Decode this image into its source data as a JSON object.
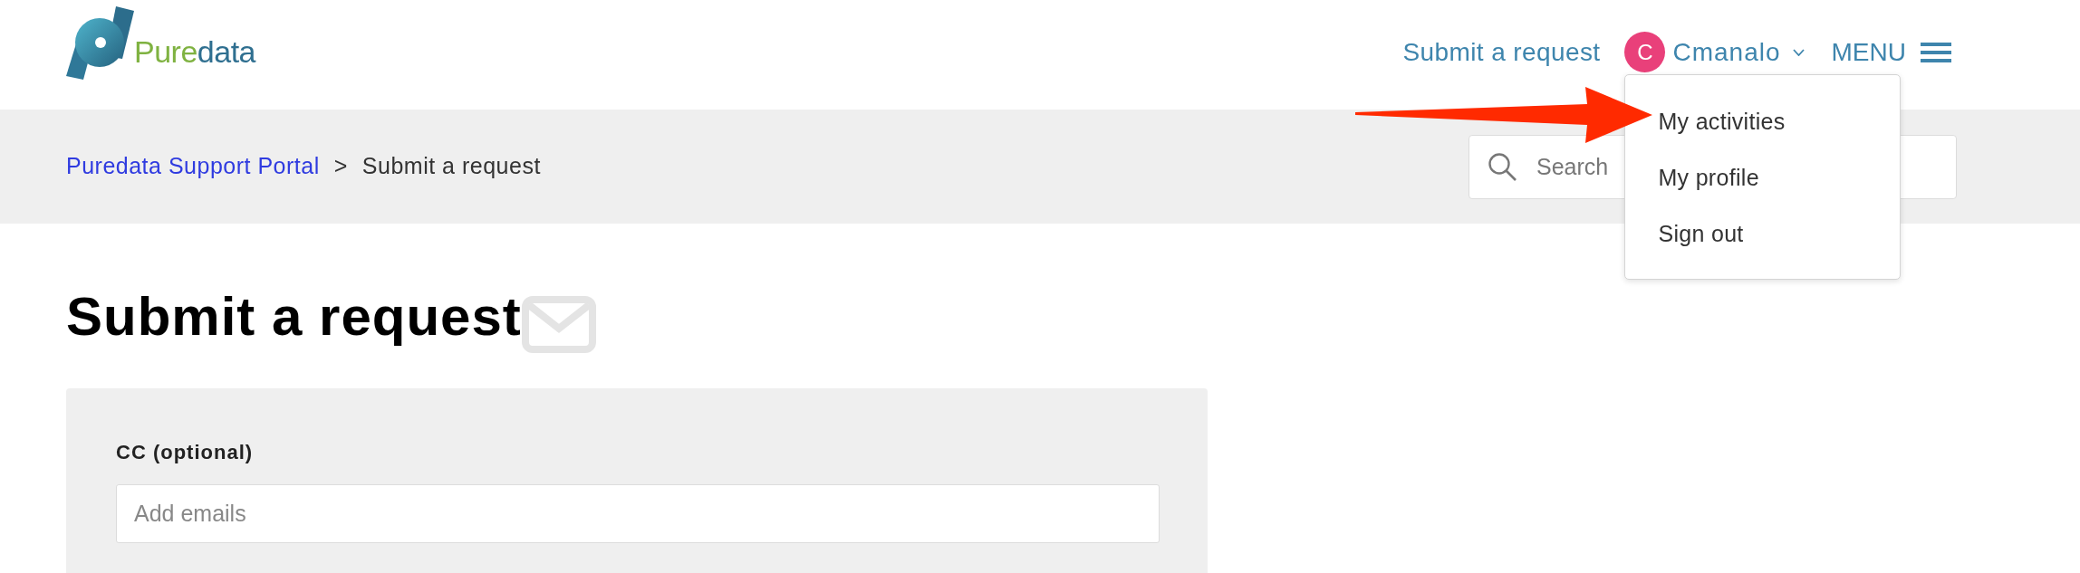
{
  "logo": {
    "brand_first": "Pure",
    "brand_second": "data"
  },
  "header": {
    "nav_link": "Submit a request",
    "user": {
      "initial": "C",
      "name": "Cmanalo"
    },
    "menu_button": "MENU"
  },
  "user_menu": {
    "expanded": true,
    "items": [
      {
        "label": "My activities"
      },
      {
        "label": "My profile"
      },
      {
        "label": "Sign out"
      }
    ]
  },
  "breadcrumb": {
    "items": [
      {
        "label": "Puredata Support Portal",
        "kind": "link"
      },
      {
        "label": "Submit a request",
        "kind": "current"
      }
    ],
    "separator": ">"
  },
  "search": {
    "placeholder": "Search"
  },
  "page_title": "Submit a request",
  "form": {
    "fields": [
      {
        "label": "CC (optional)",
        "placeholder": "Add emails"
      }
    ]
  }
}
